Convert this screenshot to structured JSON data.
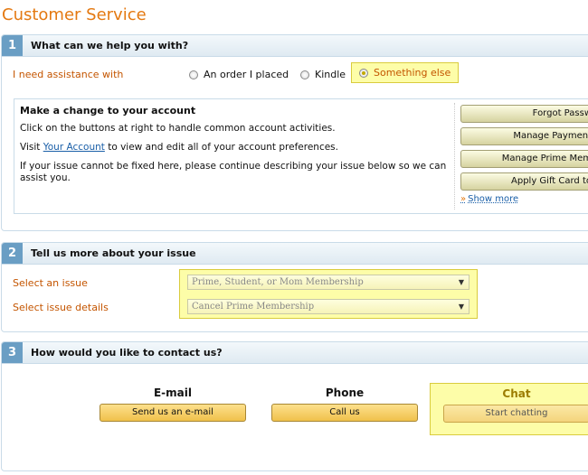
{
  "page_title": "Customer Service",
  "section1": {
    "number": "1",
    "title": "What can we help you with?",
    "assist_label": "I need assistance with",
    "options": [
      {
        "label": "An order I placed",
        "selected": false
      },
      {
        "label": "Kindle",
        "selected": false
      },
      {
        "label": "Something else",
        "selected": true
      }
    ],
    "account": {
      "title": "Make a change to your account",
      "line1": "Click on the buttons at right to handle common account activities.",
      "line2_prefix": "Visit ",
      "line2_link": "Your Account",
      "line2_suffix": " to view and edit all of your account preferences.",
      "line3": "If your issue cannot be fixed here, please continue describing your issue below so we can assist you.",
      "buttons": [
        "Forgot Passw",
        "Manage Payment",
        "Manage Prime Mem",
        "Apply Gift Card to"
      ],
      "show_more": "Show more"
    }
  },
  "section2": {
    "number": "2",
    "title": "Tell us more about your issue",
    "issue_label": "Select an issue",
    "details_label": "Select issue details",
    "issue_value": "Prime, Student, or Mom Membership",
    "details_value": "Cancel Prime Membership"
  },
  "section3": {
    "number": "3",
    "title": "How would you like to contact us?",
    "email_title": "E-mail",
    "email_button": "Send us an e-mail",
    "phone_title": "Phone",
    "phone_button": "Call us",
    "chat_title": "Chat",
    "chat_button": "Start chatting"
  },
  "colors": {
    "accent": "#e47911",
    "highlight": "#fdfda8",
    "link": "#1a5fa8",
    "section_num": "#6a9ec4"
  }
}
